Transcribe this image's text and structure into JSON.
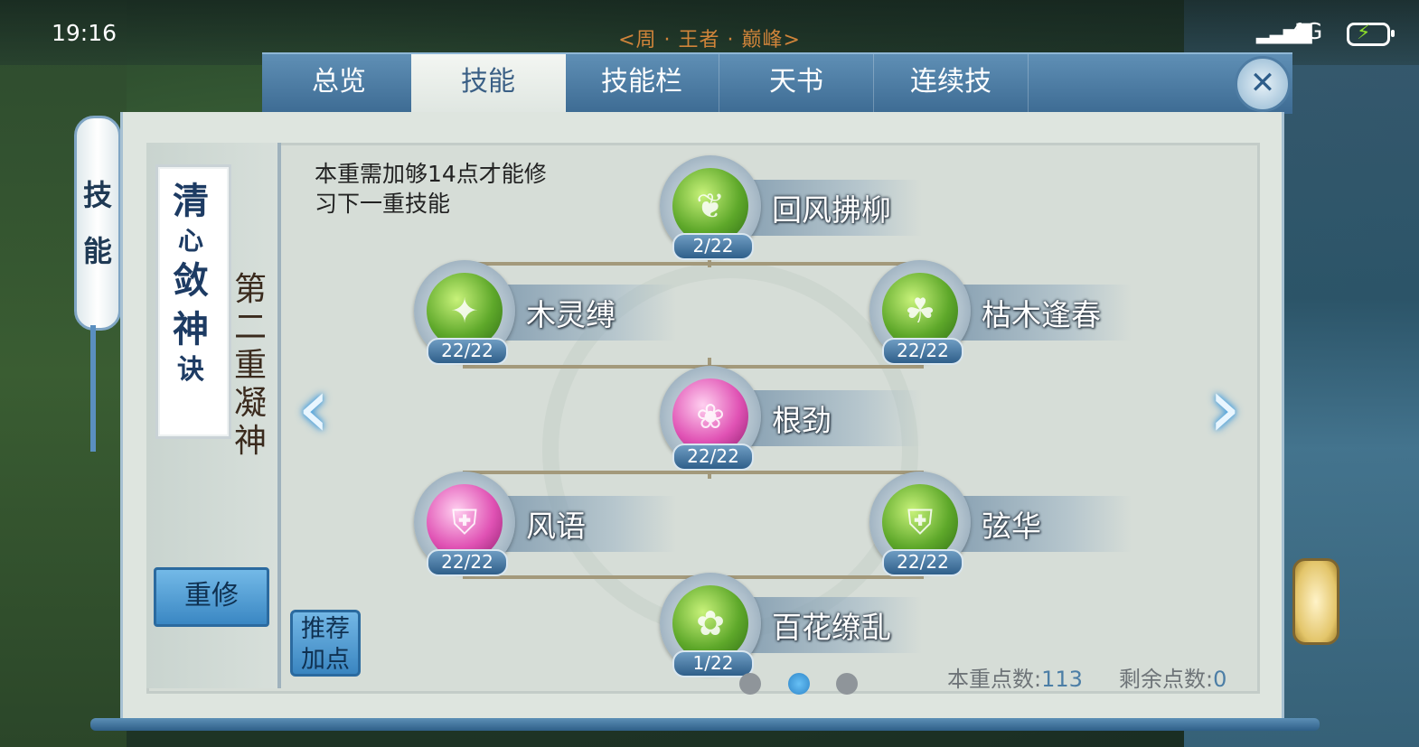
{
  "status": {
    "time": "19:16",
    "title": "<周 · 王者 · 巅峰>",
    "network": "4G",
    "signal_icon": "signal-bars-icon",
    "battery_icon": "battery-charging-icon"
  },
  "tabs": [
    {
      "label": "总览",
      "active": false
    },
    {
      "label": "技能",
      "active": true
    },
    {
      "label": "技能栏",
      "active": false
    },
    {
      "label": "天书",
      "active": false
    },
    {
      "label": "连续技",
      "active": false
    }
  ],
  "side_label": [
    "技",
    "能"
  ],
  "school": {
    "name_chars": [
      "清",
      "心",
      "敛",
      "神",
      "诀"
    ],
    "tier_chars": [
      "第",
      "二",
      "重",
      "凝",
      "神"
    ]
  },
  "requirement": "本重需加够14点才能修习下一重技能",
  "buttons": {
    "reset": "重修",
    "recommend_line1": "推荐",
    "recommend_line2": "加点"
  },
  "skills": [
    {
      "name": "回风拂柳",
      "level": "2/22",
      "orb": "green"
    },
    {
      "name": "木灵缚",
      "level": "22/22",
      "orb": "green"
    },
    {
      "name": "枯木逢春",
      "level": "22/22",
      "orb": "green"
    },
    {
      "name": "根劲",
      "level": "22/22",
      "orb": "pink"
    },
    {
      "name": "风语",
      "level": "22/22",
      "orb": "pink"
    },
    {
      "name": "弦华",
      "level": "22/22",
      "orb": "green"
    },
    {
      "name": "百花缭乱",
      "level": "1/22",
      "orb": "green"
    }
  ],
  "points": {
    "tier_label": "本重点数:",
    "tier_value": "113",
    "remaining_label": "剩余点数:",
    "remaining_value": "0"
  },
  "pagination": {
    "pages": 3,
    "active": 2
  },
  "colors": {
    "accent": "#3a87c3",
    "title_orange": "#d0843a",
    "point_value": "#4c7ea6"
  }
}
